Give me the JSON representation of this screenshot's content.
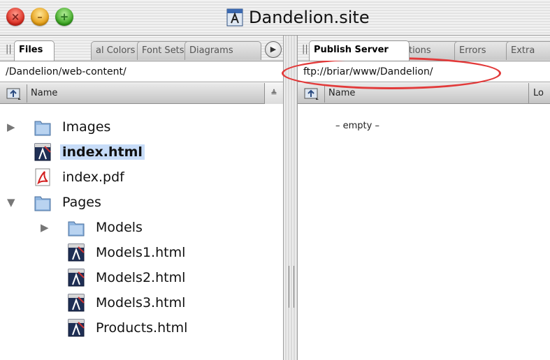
{
  "window": {
    "title": "Dandelion.site"
  },
  "left": {
    "tabs": [
      "Files",
      "al Colors",
      "Font Sets",
      "Diagrams"
    ],
    "path": "/Dandelion/web-content/",
    "column_name": "Name",
    "items": [
      {
        "label": "Images",
        "type": "folder",
        "expander": "collapsed",
        "selected": false
      },
      {
        "label": "index.html",
        "type": "html",
        "expander": "none",
        "selected": true
      },
      {
        "label": "index.pdf",
        "type": "pdf",
        "expander": "none",
        "selected": false
      },
      {
        "label": "Pages",
        "type": "folder",
        "expander": "expanded",
        "selected": false
      },
      {
        "label": "Models",
        "type": "folder",
        "expander": "collapsed",
        "selected": false
      },
      {
        "label": "Models1.html",
        "type": "html",
        "expander": "none",
        "selected": false
      },
      {
        "label": "Models2.html",
        "type": "html",
        "expander": "none",
        "selected": false
      },
      {
        "label": "Models3.html",
        "type": "html",
        "expander": "none",
        "selected": false
      },
      {
        "label": "Products.html",
        "type": "html",
        "expander": "none",
        "selected": false
      }
    ]
  },
  "right": {
    "tabs": [
      "Publish Server",
      "tions",
      "Errors",
      "Extra"
    ],
    "path": "ftp://briar/www/Dandelion/",
    "column_name": "Name",
    "column_location": "Lo",
    "empty_text": "– empty –"
  },
  "colors": {
    "highlight": "#e23a3a",
    "selection": "#c7dcf8"
  },
  "icons": {
    "close": "close-icon",
    "minimize": "minimize-icon",
    "zoom": "zoom-icon"
  }
}
